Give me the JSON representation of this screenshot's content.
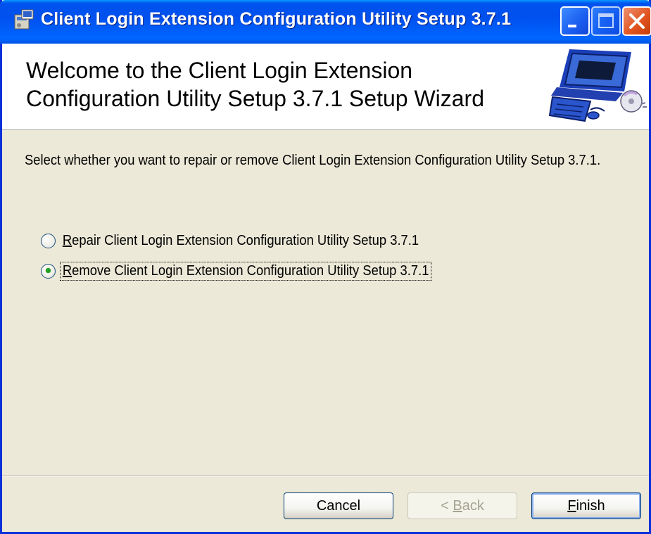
{
  "window": {
    "title": "Client Login Extension Configuration Utility Setup 3.7.1",
    "controls": {
      "minimize": "minimize-icon",
      "maximize": "maximize-icon",
      "close": "close-icon"
    }
  },
  "header": {
    "title": "Welcome to the Client Login Extension\nConfiguration Utility Setup 3.7.1 Setup Wizard",
    "icon": "computer-setup-icon"
  },
  "body": {
    "instruction": "Select whether you want to repair or remove Client Login Extension Configuration Utility Setup 3.7.1.",
    "options": [
      {
        "mnemonic": "R",
        "label_rest": "epair Client Login Extension Configuration Utility Setup 3.7.1",
        "selected": false
      },
      {
        "mnemonic": "R",
        "label_rest": "emove Client Login Extension Configuration Utility Setup 3.7.1",
        "selected": true
      }
    ]
  },
  "buttons": {
    "cancel": "Cancel",
    "back_prefix": "< ",
    "back_mnemonic": "B",
    "back_rest": "ack",
    "back_enabled": false,
    "finish_mnemonic": "F",
    "finish_rest": "inish"
  },
  "colors": {
    "titlebar": "#0055e5",
    "dialog_bg": "#ece9d8",
    "radio_dot": "#21a121"
  }
}
